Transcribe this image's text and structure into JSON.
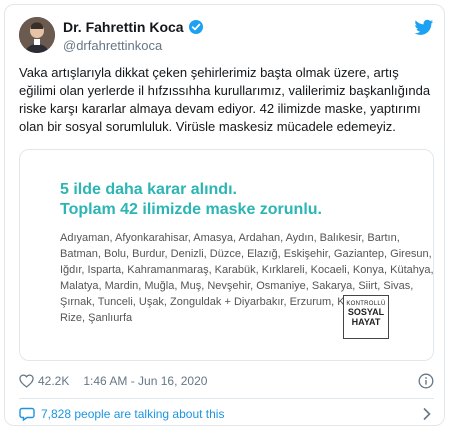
{
  "tweet": {
    "author_name": "Dr. Fahrettin Koca",
    "handle": "@drfahrettinkoca",
    "text": "Vaka artışlarıyla dikkat çeken şehirlerimiz başta olmak üzere, artış eğilimi olan yerlerde il hıfzıssıhha kurullarımız, valilerimiz başkanlığında riske karşı kararlar almaya devam ediyor. 42 ilimizde maske, yaptırımı olan bir sosyal sorumluluk. Virüsle maskesiz mücadele edemeyiz.",
    "likes": "42.2K",
    "timestamp": "1:46 AM - Jun 16, 2020",
    "talking": "7,828 people are talking about this"
  },
  "media": {
    "headline_1": "5 ilde daha karar alındı.",
    "headline_2": "Toplam 42 ilimizde maske zorunlu.",
    "provinces_lines": [
      "Adıyaman, Afyonkarahisar, Amasya, Ardahan, Aydın, Balıkesir, Bartın,",
      "Batman, Bolu, Burdur, Denizli, Düzce, Elazığ, Eskişehir, Gaziantep, Giresun,",
      "Iğdır, Isparta, Kahramanmaraş, Karabük, Kırklareli, Kocaeli, Konya, Kütahya,",
      "Malatya, Mardin, Muğla, Muş, Nevşehir, Osmaniye, Sakarya, Siirt, Sivas,",
      "Şırnak, Tunceli, Uşak, Zonguldak + Diyarbakır, Erzurum, Kayseri,",
      "Rize, Şanlıurfa"
    ],
    "logo_line1": "KONTROLLÜ",
    "logo_line2": "SOSYAL",
    "logo_line3": "HAYAT"
  },
  "colors": {
    "accent_blue": "#1b95e0",
    "headline_teal": "#2bb5b4",
    "muted": "#657786"
  },
  "icons": [
    "twitter-bird-icon",
    "verified-badge-icon",
    "heart-icon",
    "info-icon",
    "comment-bubble-icon",
    "chevron-right-icon"
  ]
}
